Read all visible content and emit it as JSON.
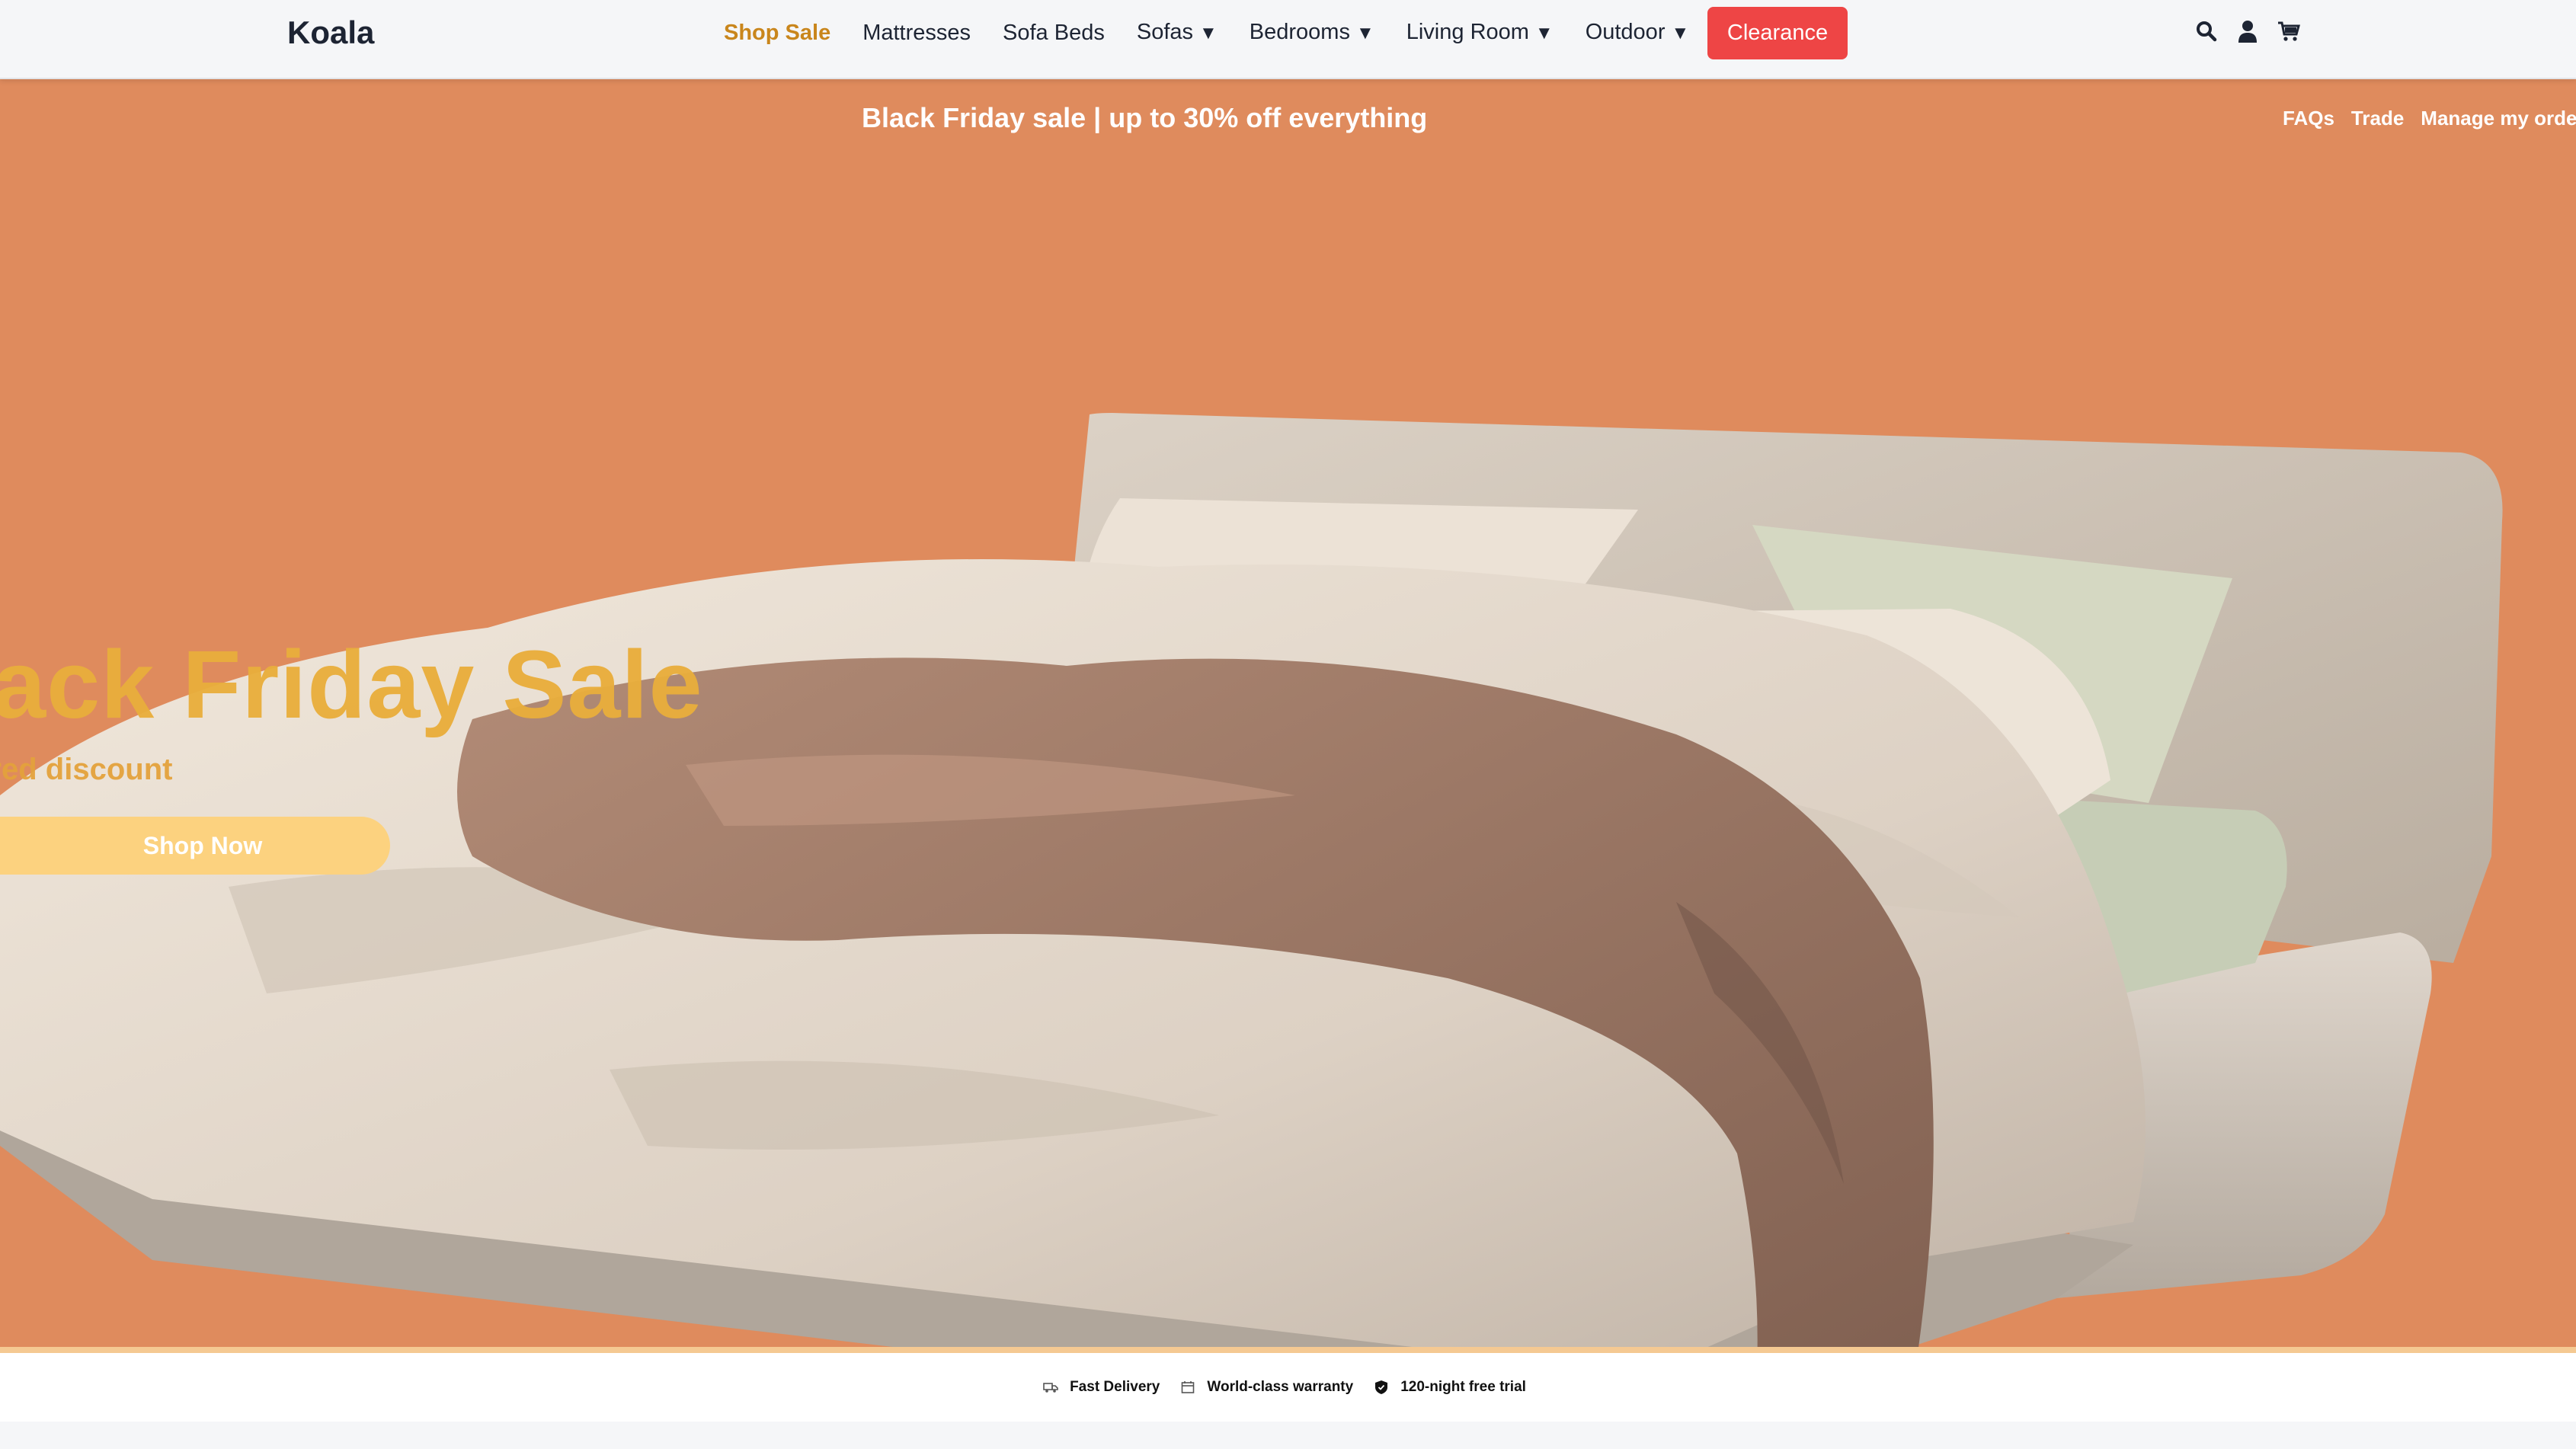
{
  "header": {
    "logo": "Koala",
    "nav": [
      {
        "label": "Shop Sale",
        "caret": ""
      },
      {
        "label": "Mattresses",
        "caret": ""
      },
      {
        "label": "Sofa Beds",
        "caret": ""
      },
      {
        "label": "Sofas",
        "caret": "▼"
      },
      {
        "label": "Bedrooms",
        "caret": "▼"
      },
      {
        "label": "Living Room",
        "caret": "▼"
      },
      {
        "label": "Outdoor",
        "caret": "▼"
      }
    ],
    "clearance_label": "Clearance",
    "icons": [
      "search-icon",
      "user-icon",
      "cart-icon"
    ]
  },
  "hero": {
    "promo_text": "Black Friday sale | up to 30% off everything",
    "util_links": [
      "FAQs",
      "Trade",
      "Manage my order"
    ],
    "title": "lack Friday Sale",
    "subtitle": "ured discount",
    "cta_label": "Shop Now",
    "colors": {
      "background": "#df8b5d",
      "title": "#e9ae3c",
      "cta": "#fcd27f"
    }
  },
  "features": [
    {
      "icon": "truck-icon",
      "label": "Fast Delivery"
    },
    {
      "icon": "calendar-icon",
      "label": "World-class warranty"
    },
    {
      "icon": "shield-icon",
      "label": "120-night free trial"
    }
  ]
}
